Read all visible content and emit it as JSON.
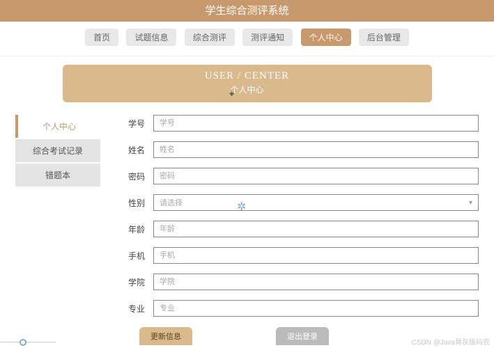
{
  "header": {
    "title": "学生综合测评系统"
  },
  "nav": {
    "items": [
      {
        "label": "首页"
      },
      {
        "label": "试题信息"
      },
      {
        "label": "综合测评"
      },
      {
        "label": "测评通知"
      },
      {
        "label": "个人中心"
      },
      {
        "label": "后台管理"
      }
    ],
    "active_index": 4
  },
  "banner": {
    "en": "USER / CENTER",
    "cn": "个人中心"
  },
  "sidebar": {
    "items": [
      {
        "label": "个人中心"
      },
      {
        "label": "综合考试记录"
      },
      {
        "label": "错题本"
      }
    ],
    "active_index": 0
  },
  "form": {
    "fields": [
      {
        "label": "学号",
        "placeholder": "学号",
        "type": "text"
      },
      {
        "label": "姓名",
        "placeholder": "姓名",
        "type": "text"
      },
      {
        "label": "密码",
        "placeholder": "密码",
        "type": "text"
      },
      {
        "label": "性别",
        "placeholder": "请选择",
        "type": "select"
      },
      {
        "label": "年龄",
        "placeholder": "年龄",
        "type": "text"
      },
      {
        "label": "手机",
        "placeholder": "手机",
        "type": "text"
      },
      {
        "label": "学院",
        "placeholder": "学院",
        "type": "text"
      },
      {
        "label": "专业",
        "placeholder": "专业",
        "type": "text"
      }
    ]
  },
  "actions": {
    "update": "更新信息",
    "logout": "退出登录"
  },
  "watermark": "CSDN @Java骨灰级码农"
}
